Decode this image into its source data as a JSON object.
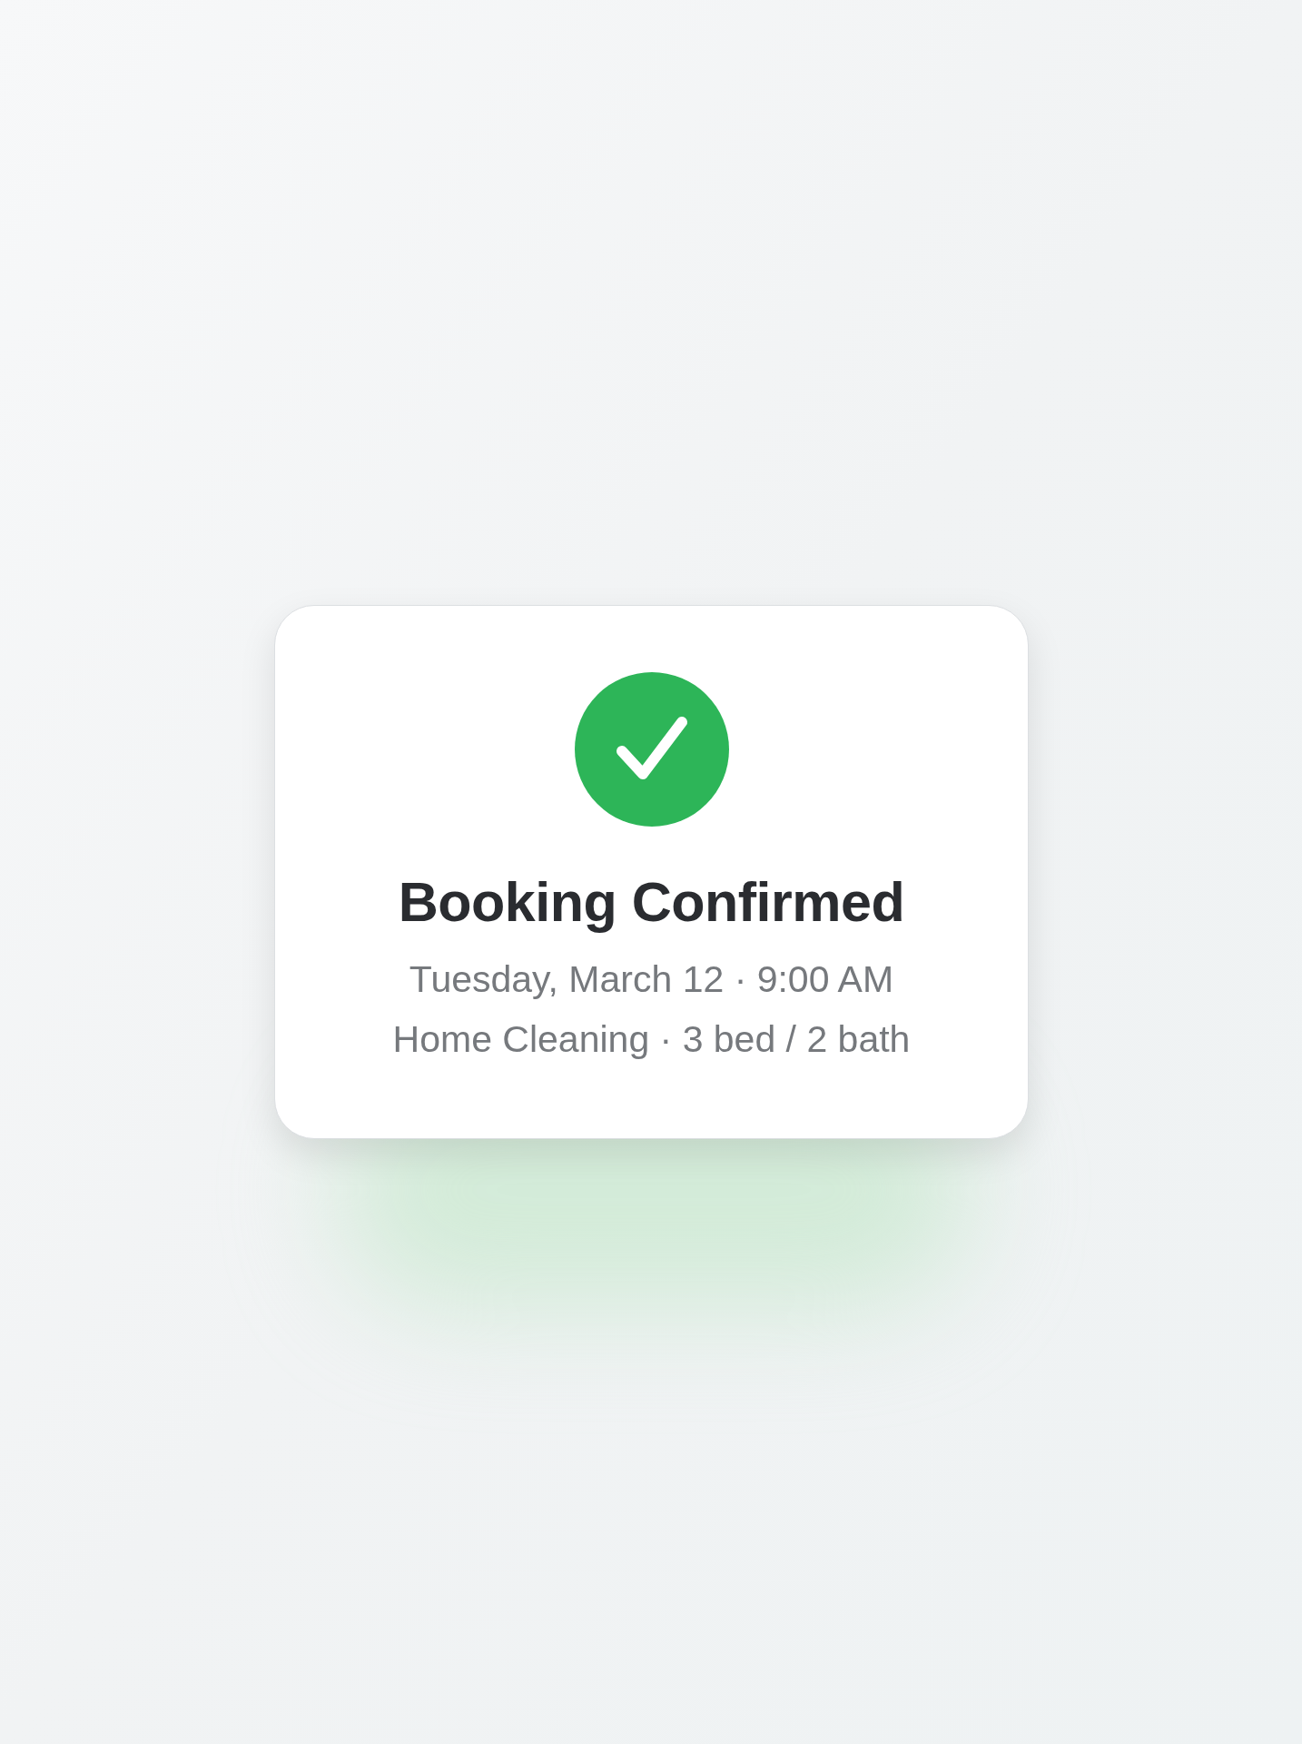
{
  "card": {
    "title": "Booking Confirmed",
    "lines": [
      "Tuesday, March 12 · 9:00 AM",
      "Home Cleaning · 3 bed / 2 bath"
    ]
  }
}
